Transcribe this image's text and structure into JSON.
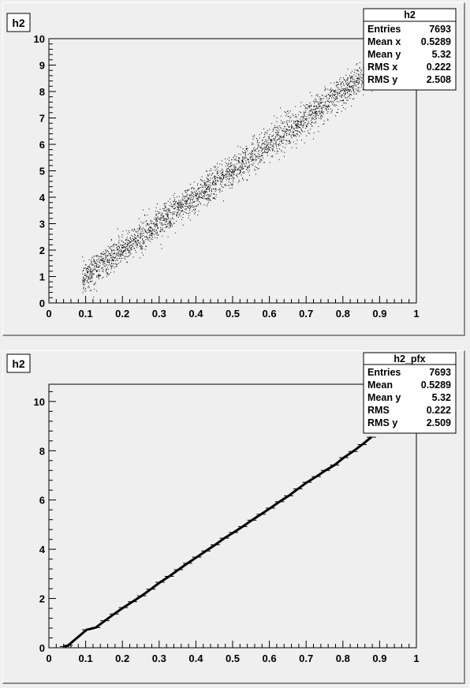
{
  "chart_data": [
    {
      "type": "scatter",
      "title": "h2",
      "xlim": [
        0,
        1
      ],
      "ylim": [
        0,
        10
      ],
      "x_ticks": [
        "0",
        "0.1",
        "0.2",
        "0.3",
        "0.4",
        "0.5",
        "0.6",
        "0.7",
        "0.8",
        "0.9",
        "1"
      ],
      "y_ticks": [
        "0",
        "1",
        "2",
        "3",
        "4",
        "5",
        "6",
        "7",
        "8",
        "9",
        "10"
      ],
      "relation": {
        "slope": 10.0,
        "intercept": 0.03,
        "y_spread": 0.3,
        "x_from": 0.09,
        "x_to": 1.0
      },
      "entries": 7693,
      "stats_box": {
        "title": "h2",
        "rows": [
          {
            "label": "Entries",
            "value": "7693"
          },
          {
            "label": "Mean x",
            "value": "0.5289"
          },
          {
            "label": "Mean y",
            "value": "5.32"
          },
          {
            "label": "RMS x",
            "value": "0.222"
          },
          {
            "label": "RMS y",
            "value": "2.508"
          }
        ]
      }
    },
    {
      "type": "profile",
      "title": "h2",
      "xlim": [
        0,
        1
      ],
      "ylim": [
        0,
        10.7
      ],
      "x_ticks": [
        "0",
        "0.1",
        "0.2",
        "0.3",
        "0.4",
        "0.5",
        "0.6",
        "0.7",
        "0.8",
        "0.9",
        "1"
      ],
      "y_ticks": [
        "0",
        "2",
        "4",
        "6",
        "8",
        "10"
      ],
      "x": [
        0.0425,
        0.0525,
        0.1025,
        0.1275,
        0.1525,
        0.1775,
        0.2025,
        0.2275,
        0.2525,
        0.2775,
        0.3025,
        0.3275,
        0.3525,
        0.3775,
        0.4025,
        0.4275,
        0.4525,
        0.4775,
        0.5025,
        0.5275,
        0.5525,
        0.5775,
        0.6025,
        0.6275,
        0.6525,
        0.6775,
        0.7025,
        0.7275,
        0.7525,
        0.7775,
        0.8025,
        0.8275,
        0.8525,
        0.8775
      ],
      "y": [
        0.05,
        0.1,
        0.73,
        0.82,
        1.1,
        1.37,
        1.63,
        1.87,
        2.11,
        2.38,
        2.66,
        2.9,
        3.17,
        3.43,
        3.68,
        3.93,
        4.18,
        4.45,
        4.68,
        4.92,
        5.18,
        5.42,
        5.67,
        5.93,
        6.17,
        6.45,
        6.72,
        6.95,
        7.2,
        7.42,
        7.72,
        7.97,
        8.25,
        8.55
      ],
      "bin_halfwidth": 0.0125,
      "stats_box": {
        "title": "h2_pfx",
        "rows": [
          {
            "label": "Entries",
            "value": "7693"
          },
          {
            "label": "Mean",
            "value": "0.5289"
          },
          {
            "label": "Mean y",
            "value": "5.32"
          },
          {
            "label": "RMS",
            "value": "0.222"
          },
          {
            "label": "RMS y",
            "value": "2.509"
          }
        ]
      }
    }
  ]
}
